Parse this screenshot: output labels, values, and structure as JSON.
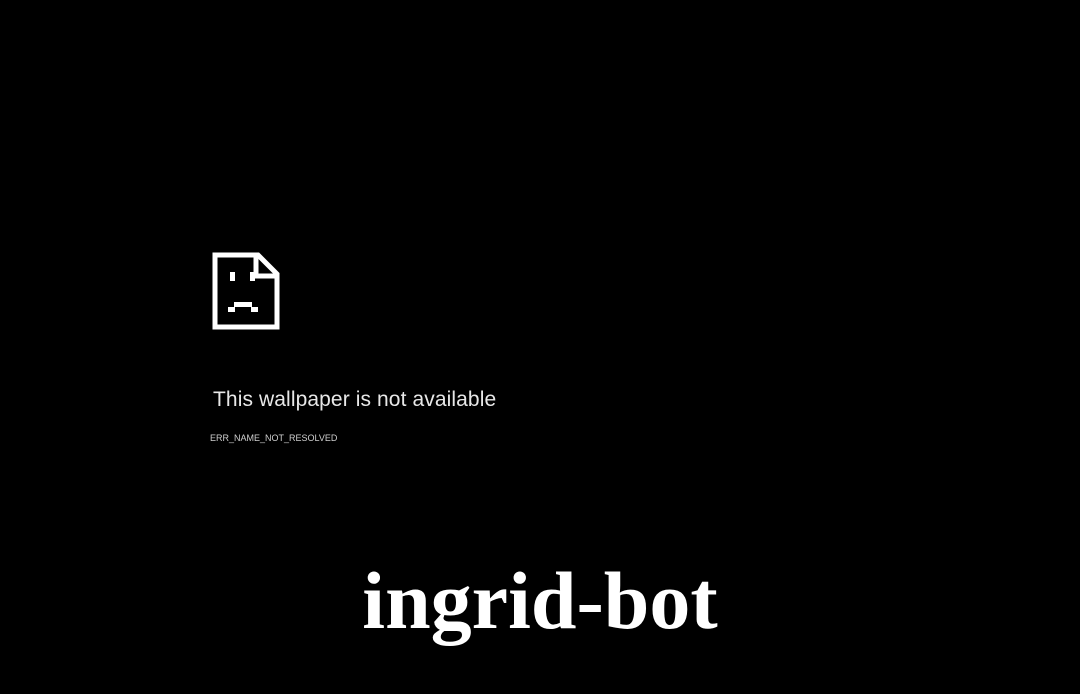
{
  "error": {
    "icon": "sad-page-icon",
    "title": "This wallpaper is not available",
    "code": "ERR_NAME_NOT_RESOLVED"
  },
  "watermark": {
    "text": "ingrid-bot"
  },
  "colors": {
    "background": "#000000",
    "text": "#e8e8e8",
    "icon": "#ffffff"
  }
}
